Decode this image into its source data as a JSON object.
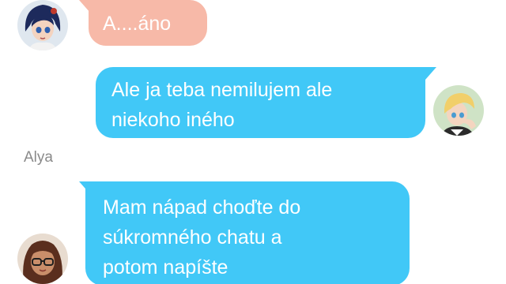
{
  "messages": [
    {
      "side": "left",
      "avatar_icon": "girl-blue-hair-avatar-icon",
      "text": "A....áno",
      "color": "#f7b9a8"
    },
    {
      "side": "right",
      "avatar_icon": "boy-blonde-avatar-icon",
      "text": "Ale ja teba nemilujem ale\nniekoho iného",
      "color": "#41c8f7"
    },
    {
      "side": "left",
      "sender": "Alya",
      "avatar_icon": "girl-glasses-avatar-icon",
      "text": "Mam nápad choďte do\nsúkromného chatu a\npotom napíšte",
      "color": "#41c8f7"
    }
  ]
}
